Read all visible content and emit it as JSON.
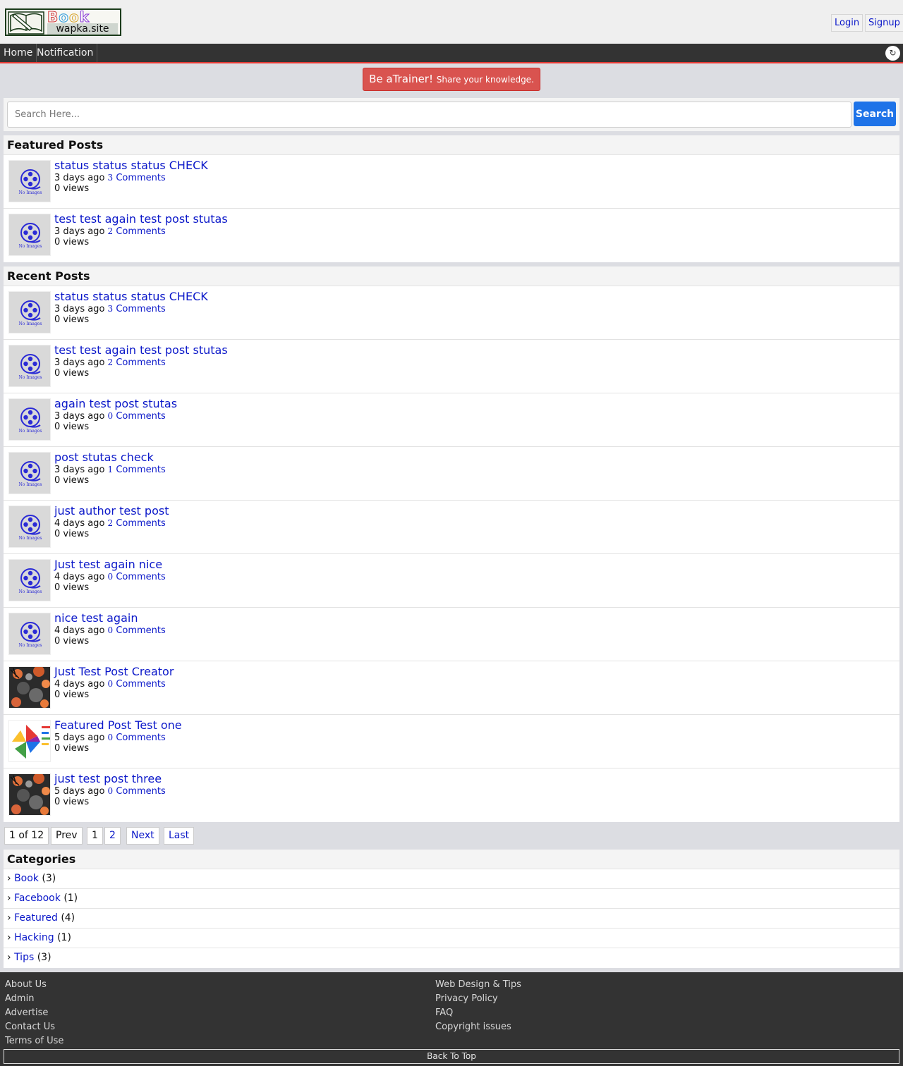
{
  "header": {
    "logo": {
      "word": "Book",
      "site": "wapka.site"
    },
    "auth": {
      "login": "Login",
      "signup": "Signup"
    }
  },
  "nav": {
    "items": [
      "Home",
      "Notification"
    ],
    "toggle_glyph": "↻"
  },
  "banner": {
    "main": "Be aTrainer!",
    "sub": "Share your knowledge."
  },
  "search": {
    "placeholder": "Search Here...",
    "button": "Search"
  },
  "featured": {
    "title": "Featured Posts",
    "posts": [
      {
        "title": "status status status CHECK",
        "time": "3 days ago",
        "comments": "3",
        "comments_label": "Comments",
        "views": "0 views",
        "thumb": "no-image"
      },
      {
        "title": "test test again test post stutas",
        "time": "3 days ago",
        "comments": "2",
        "comments_label": "Comments",
        "views": "0 views",
        "thumb": "no-image"
      }
    ]
  },
  "recent": {
    "title": "Recent Posts",
    "posts": [
      {
        "title": "status status status CHECK",
        "time": "3 days ago",
        "comments": "3",
        "comments_label": "Comments",
        "views": "0 views",
        "thumb": "no-image"
      },
      {
        "title": "test test again test post stutas",
        "time": "3 days ago",
        "comments": "2",
        "comments_label": "Comments",
        "views": "0 views",
        "thumb": "no-image"
      },
      {
        "title": "again test post stutas",
        "time": "3 days ago",
        "comments": "0",
        "comments_label": "Comments",
        "views": "0 views",
        "thumb": "no-image"
      },
      {
        "title": "post stutas check",
        "time": "3 days ago",
        "comments": "1",
        "comments_label": "Comments",
        "views": "0 views",
        "thumb": "no-image"
      },
      {
        "title": "just author test post",
        "time": "4 days ago",
        "comments": "2",
        "comments_label": "Comments",
        "views": "0 views",
        "thumb": "no-image"
      },
      {
        "title": "Just test again nice",
        "time": "4 days ago",
        "comments": "0",
        "comments_label": "Comments",
        "views": "0 views",
        "thumb": "no-image"
      },
      {
        "title": "nice test again",
        "time": "4 days ago",
        "comments": "0",
        "comments_label": "Comments",
        "views": "0 views",
        "thumb": "no-image"
      },
      {
        "title": "Just Test Post Creator",
        "time": "4 days ago",
        "comments": "0",
        "comments_label": "Comments",
        "views": "0 views",
        "thumb": "photo"
      },
      {
        "title": "Featured Post Test one",
        "time": "5 days ago",
        "comments": "0",
        "comments_label": "Comments",
        "views": "0 views",
        "thumb": "pinwheel"
      },
      {
        "title": "just test post three",
        "time": "5 days ago",
        "comments": "0",
        "comments_label": "Comments",
        "views": "0 views",
        "thumb": "photo"
      }
    ]
  },
  "no_image_text": "No Images",
  "pagination": {
    "status": "1 of 12",
    "prev": "Prev",
    "pages": [
      "1",
      "2"
    ],
    "next": "Next",
    "last": "Last"
  },
  "categories": {
    "title": "Categories",
    "marker": "›",
    "items": [
      {
        "name": "Book",
        "count": "(3)"
      },
      {
        "name": "Facebook",
        "count": "(1)"
      },
      {
        "name": "Featured",
        "count": "(4)"
      },
      {
        "name": "Hacking",
        "count": "(1)"
      },
      {
        "name": "Tips",
        "count": "(3)"
      }
    ]
  },
  "footer": {
    "left": [
      "About Us",
      "Admin",
      "Advertise",
      "Contact Us",
      "Terms of Use"
    ],
    "right": [
      "Web Design & Tips",
      "Privacy Policy",
      "FAQ",
      "Copyright issues"
    ],
    "back_to_top": "Back To Top"
  },
  "colors": {
    "link": "#0b18c9",
    "nav_bg": "#333333",
    "nav_accent": "#e53935",
    "trainer": "#d9534f",
    "search_button": "#1e73e8"
  }
}
